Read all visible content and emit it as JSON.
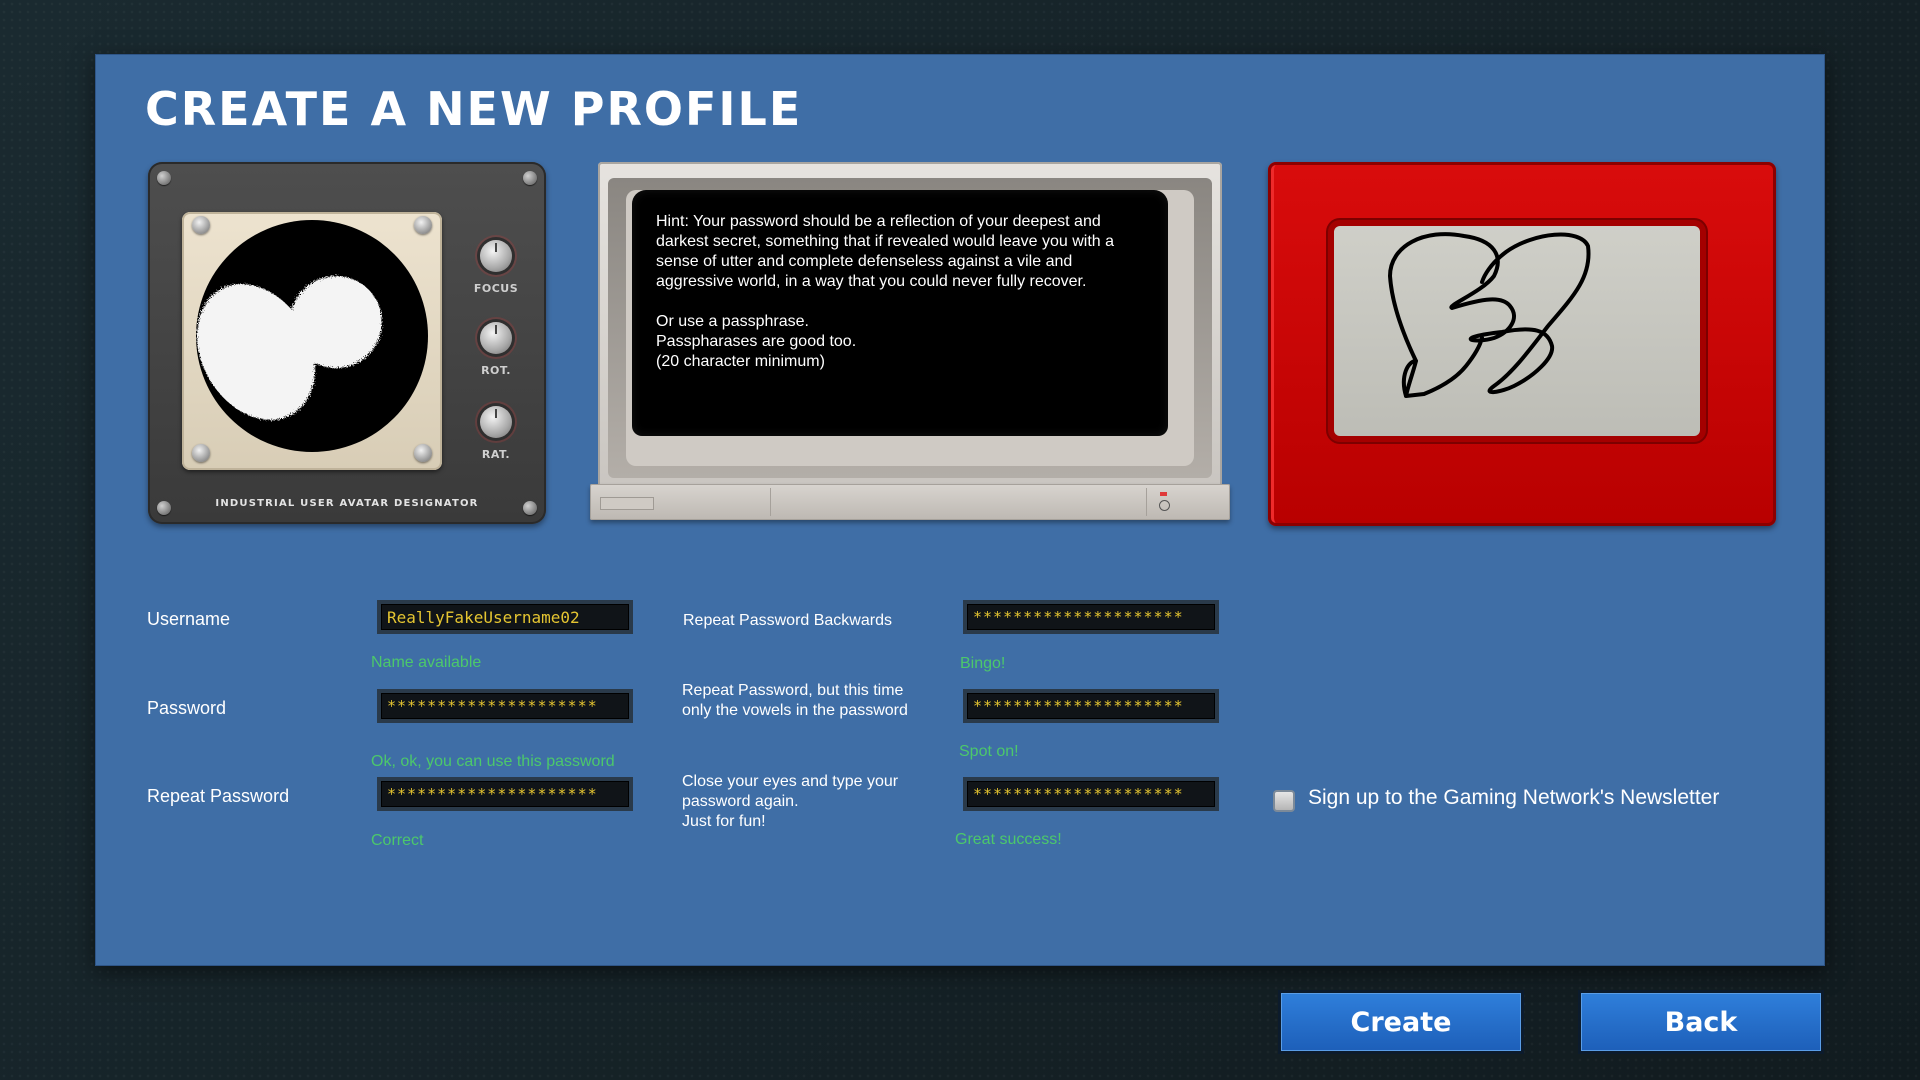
{
  "title": "CREATE A NEW PROFILE",
  "avatar": {
    "caption": "INDUSTRIAL USER AVATAR DESIGNATOR",
    "knobs": [
      "FOCUS",
      "ROT.",
      "RAT."
    ]
  },
  "hint": {
    "paragraph1": "Hint: Your password should be a reflection of your deepest and darkest secret, something that if revealed would leave you with a sense of utter and complete defenseless against a vile and aggressive world, in a way that you could never fully recover.",
    "line1": "Or use a passphrase.",
    "line2": "Passpharases are good too.",
    "line3": "(20 character minimum)"
  },
  "form": {
    "username": {
      "label": "Username",
      "value": "ReallyFakeUsername02",
      "status": "Name available"
    },
    "password": {
      "label": "Password",
      "value": "*********************",
      "status": "Ok, ok, you can use this password"
    },
    "repeat_password": {
      "label": "Repeat Password",
      "value": "*********************",
      "status": "Correct"
    },
    "repeat_backwards": {
      "label": "Repeat Password Backwards",
      "value": "*********************",
      "status": "Bingo!"
    },
    "vowels": {
      "label": "Repeat Password, but this time only the vowels in the password",
      "value": "*********************",
      "status": "Spot on!"
    },
    "eyes_closed": {
      "label_line1": "Close your eyes and type your password again.",
      "label_line2": "Just for fun!",
      "value": "*********************",
      "status": "Great success!"
    }
  },
  "newsletter": {
    "label": "Sign up to the Gaming Network's Newsletter",
    "checked": false
  },
  "buttons": {
    "create": "Create",
    "back": "Back"
  },
  "colors": {
    "panel": "#3f6ea6",
    "status_ok": "#4cc86b",
    "field_text": "#e5c531",
    "button": "#2670cc"
  }
}
